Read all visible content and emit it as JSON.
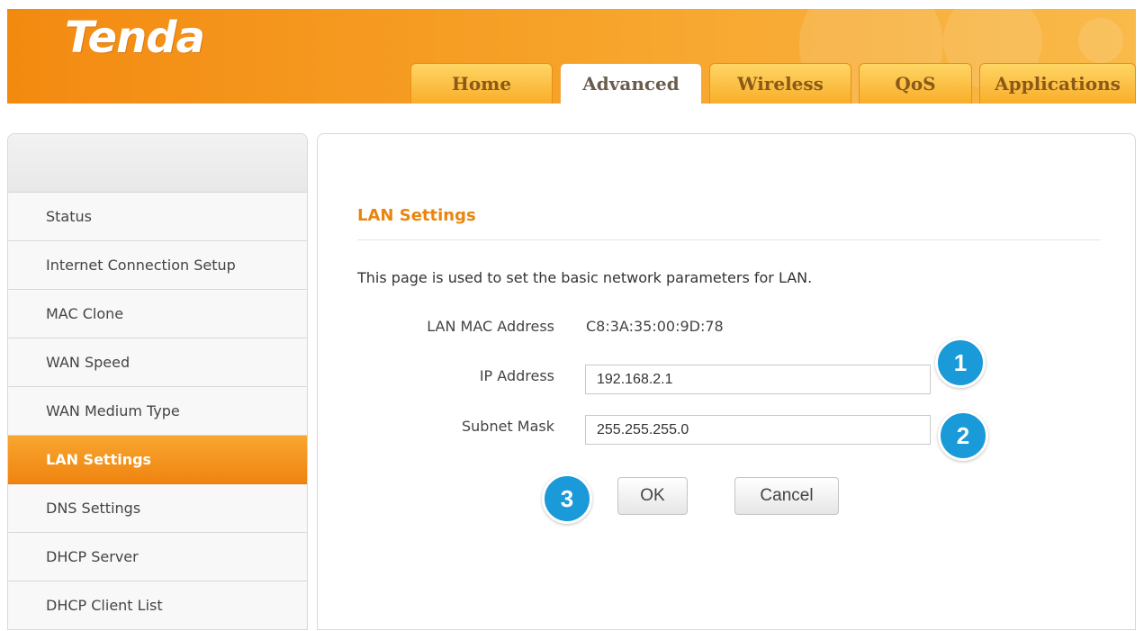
{
  "brand": {
    "logo_text": "Tenda"
  },
  "tabs": [
    {
      "label": "Home",
      "active": false
    },
    {
      "label": "Advanced",
      "active": true
    },
    {
      "label": "Wireless",
      "active": false
    },
    {
      "label": "QoS",
      "active": false
    },
    {
      "label": "Applications",
      "active": false
    }
  ],
  "sidebar": {
    "items": [
      {
        "label": "Status"
      },
      {
        "label": "Internet Connection Setup"
      },
      {
        "label": "MAC Clone"
      },
      {
        "label": "WAN Speed"
      },
      {
        "label": "WAN Medium Type"
      },
      {
        "label": "LAN Settings",
        "active": true
      },
      {
        "label": "DNS Settings"
      },
      {
        "label": "DHCP Server"
      },
      {
        "label": "DHCP Client List"
      }
    ]
  },
  "content": {
    "title": "LAN Settings",
    "description": "This page is used to set the basic network parameters for LAN.",
    "mac_label": "LAN MAC Address",
    "mac_value": "C8:3A:35:00:9D:78",
    "ip_label": "IP Address",
    "ip_value": "192.168.2.1",
    "subnet_label": "Subnet Mask",
    "subnet_value": "255.255.255.0",
    "ok_label": "OK",
    "cancel_label": "Cancel"
  },
  "callouts": {
    "one": "1",
    "two": "2",
    "three": "3"
  },
  "colors": {
    "brand_orange": "#f38a10",
    "title_orange": "#e8860f",
    "callout_blue": "#1a9ad8"
  }
}
